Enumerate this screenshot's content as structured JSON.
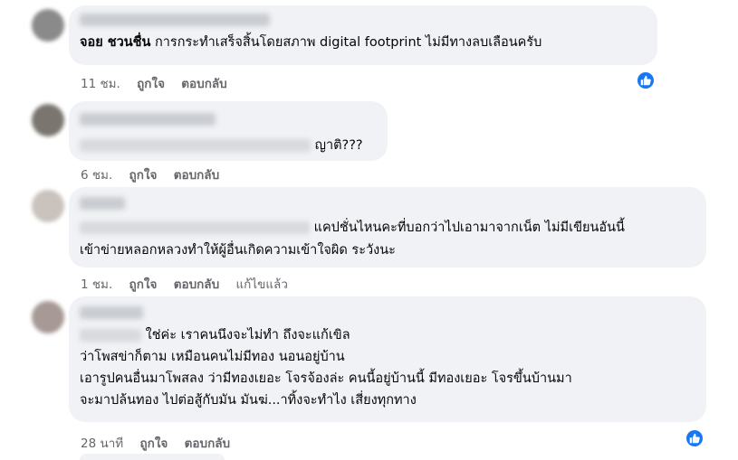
{
  "comments": [
    {
      "author": "จอย ชวนชื่น",
      "text": "การกระทำเสร็จสิ้นโดยสภาพ digital footprint ไม่มีทางลบเลือนครับ",
      "time": "11 ชม.",
      "like_label": "ถูกใจ",
      "reply_label": "ตอบกลับ"
    },
    {
      "text": "ญาติ???",
      "time": "6 ชม.",
      "like_label": "ถูกใจ",
      "reply_label": "ตอบกลับ"
    },
    {
      "lines": [
        "แคปชั่นไหนคะที่บอกว่าไปเอามาจากเน็ต ไม่มีเขียนอันนี้",
        "เข้าข่ายหลอกหลวงทำให้ผู้อื่นเกิดความเข้าใจผิด ระวังนะ"
      ],
      "time": "1 ชม.",
      "like_label": "ถูกใจ",
      "reply_label": "ตอบกลับ",
      "edited_label": "แก้ไขแล้ว"
    },
    {
      "lines": [
        "ใช่ค่ะ เราคนนึงจะไม่ทำ ถึงจะแก้เขิล",
        "ว่าโพสข่าก็ตาม เหมือนคนไม่มีทอง นอนอยู่บ้าน",
        "เอารูปคนอื่นมาโพสลง ว่ามีทองเยอะ โจรจ้องล่ะ คนนี้อยู่บ้านนี้ มีทองเยอะ โจรขึ้นบ้านมา",
        "จะมาปล้นทอง ไปต่อสู้กับมัน มันฆ่...าทิ้งจะทำไง เสี่ยงทุกทาง"
      ],
      "time": "28 นาที",
      "like_label": "ถูกใจ",
      "reply_label": "ตอบกลับ"
    }
  ],
  "colors": {
    "bubble": "#f0f2f5",
    "meta_text": "#65676b",
    "like_blue": "#1877f2"
  },
  "icons": [
    "like-thumb-icon"
  ]
}
